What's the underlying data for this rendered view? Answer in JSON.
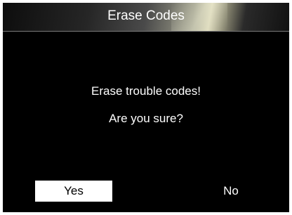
{
  "header": {
    "title": "Erase Codes"
  },
  "dialog": {
    "message_line1": "Erase trouble codes!",
    "message_line2": "Are you sure?"
  },
  "buttons": {
    "yes_label": "Yes",
    "no_label": "No",
    "selected": "Yes"
  },
  "colors": {
    "background": "#000000",
    "text": "#ffffff",
    "selected_button_bg": "#ffffff",
    "selected_button_text": "#000000"
  }
}
